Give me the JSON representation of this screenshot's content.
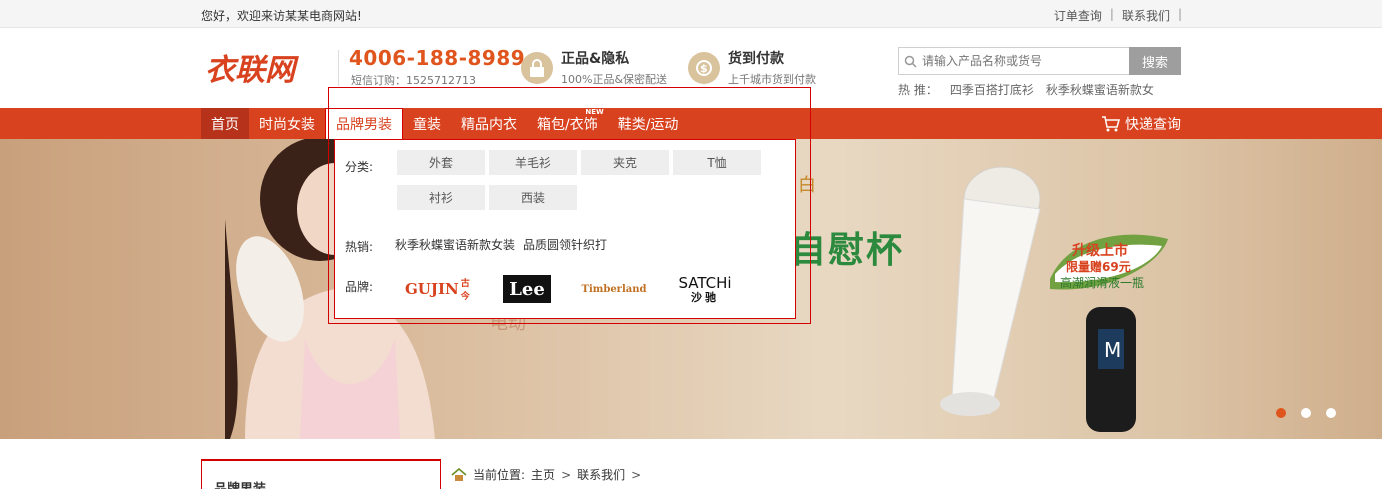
{
  "topbar": {
    "welcome": "您好，欢迎来访某某电商网站!",
    "links": [
      "订单查询",
      "联系我们"
    ]
  },
  "header": {
    "logo_text": "衣联网",
    "phone": "4006-188-8989",
    "sms": "短信订购：1525712713",
    "features": [
      {
        "icon": "lock-icon",
        "title": "正品&隐私",
        "desc": "100%正品&保密配送"
      },
      {
        "icon": "money-icon",
        "title": "货到付款",
        "desc": "上千城市货到付款"
      }
    ],
    "search": {
      "placeholder": "请输入产品名称或货号",
      "button": "搜索"
    },
    "hot_label": "热 推：",
    "hot_links": [
      "四季百搭打底衫",
      "秋季秋蝶蜜语新款女"
    ]
  },
  "nav": {
    "items": [
      "首页",
      "时尚女装",
      "品牌男装",
      "童装",
      "精品内衣",
      "箱包/衣饰",
      "鞋类/运动"
    ],
    "new_badge": "NEW",
    "express": "快递查询"
  },
  "dropdown": {
    "category_label": "分类:",
    "categories": [
      "外套",
      "羊毛衫",
      "夹克",
      "T恤",
      "衬衫",
      "西装"
    ],
    "hot_label": "热销:",
    "hot_items": [
      "秋季秋蝶蜜语新款女装",
      "品质圆领针织打"
    ],
    "brand_label": "品牌:",
    "brands": [
      "GUJIN",
      "Lee",
      "Timberland",
      "SATCHi"
    ],
    "brand_gujin": {
      "latin": "GUJIN",
      "cn": "古今"
    },
    "brand_lee": "Lee",
    "brand_timberland": "Timberland",
    "brand_satchi": {
      "latin": "SATCHi",
      "cn": "沙驰"
    }
  },
  "banner": {
    "slogan": "自慰杯",
    "slogan_top": "白",
    "faint_text": "电动",
    "promo": [
      "升级上市",
      "限量赠69元",
      "高潮润滑液一瓶"
    ],
    "slides": 3,
    "active_slide": 1
  },
  "sidebar": {
    "title": "品牌男装"
  },
  "breadcrumb": {
    "label": "当前位置:",
    "items": [
      "主页",
      "联系我们"
    ]
  },
  "colors": {
    "brand": "#d8421f",
    "nav_active": "#b7321a",
    "accent": "#e0551d"
  }
}
